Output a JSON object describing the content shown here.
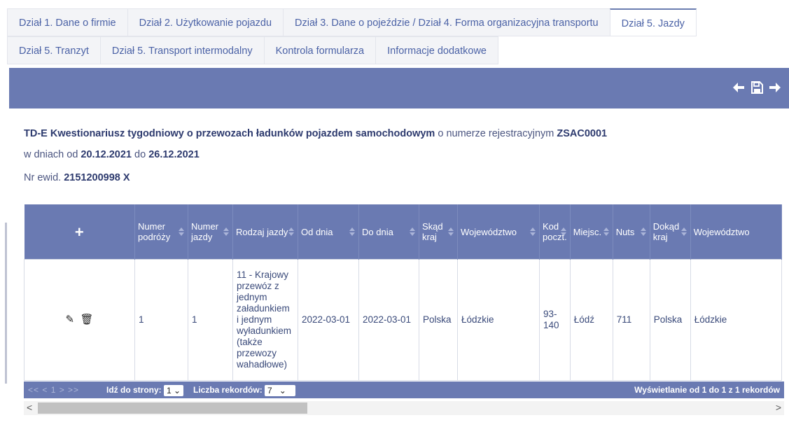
{
  "tabs": {
    "row1": [
      "Dział 1. Dane o firmie",
      "Dział 2. Użytkowanie pojazdu",
      "Dział 3. Dane o pojeździe / Dział 4. Forma organizacyjna transportu",
      "Dział 5. Jazdy"
    ],
    "row2": [
      "Dział 5. Tranzyt",
      "Dział 5. Transport intermodalny",
      "Kontrola formularza",
      "Informacje dodatkowe"
    ],
    "active": "Dział 5. Jazdy"
  },
  "toolbar": {
    "icons": [
      "arrow-left-icon",
      "save-icon",
      "arrow-right-icon"
    ]
  },
  "form_info": {
    "title_bold": "TD-E Kwestionariusz tygodniowy o przewozach ładunków pojazdem samochodowym",
    "reg_text": "o numerze rejestracyjnym",
    "reg_number": "ZSAC0001",
    "dates_prefix": "w dniach od",
    "date_from": "20.12.2021",
    "dates_mid": "do",
    "date_to": "26.12.2021",
    "ewid_prefix": "Nr ewid.",
    "ewid_number": "2151200998 X"
  },
  "table": {
    "add_symbol": "+",
    "headers": [
      "Numer podróży",
      "Numer jazdy",
      "Rodzaj jazdy",
      "Od dnia",
      "Do dnia",
      "Skąd kraj",
      "Województwo",
      "Kod poczt.",
      "Miejsc.",
      "Nuts",
      "Dokąd kraj",
      "Województwo"
    ],
    "rows": [
      {
        "cells": [
          "1",
          "1",
          "11 - Krajowy przewóz z jednym załadunkiem i jednym wyładunkiem (także przewozy wahadłowe)",
          "2022-03-01",
          "2022-03-01",
          "Polska",
          "Łódzkie",
          "93-140",
          "Łódź",
          "711",
          "Polska",
          "Łódzkie"
        ]
      }
    ]
  },
  "pager": {
    "nav": "<< < 1 > >>",
    "goto_label": "Idź do strony:",
    "page_value": "1",
    "records_label": "Liczba rekordów:",
    "records_value": "7",
    "summary": "Wyświetlanie od 1 do 1 z 1 rekordów"
  },
  "colors": {
    "accent": "#6a7ab2",
    "tab_text": "#4b62a6"
  }
}
